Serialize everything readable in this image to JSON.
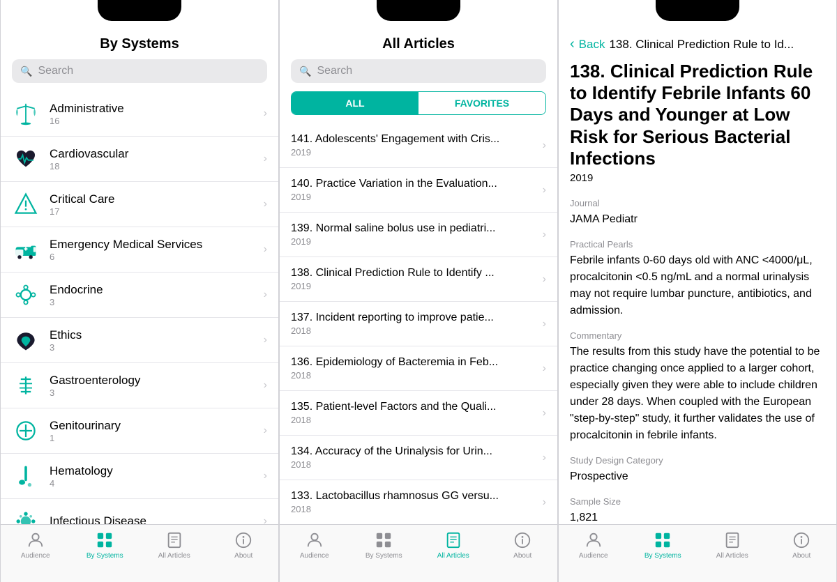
{
  "colors": {
    "accent": "#00b4a0",
    "text_primary": "#000000",
    "text_secondary": "#8e8e93",
    "border": "#e5e5ea",
    "search_bg": "#e9e9eb",
    "tab_bg": "#f9f9f9"
  },
  "phone1": {
    "title": "By Systems",
    "search_placeholder": "Search",
    "categories": [
      {
        "name": "Administrative",
        "count": "16",
        "icon": "scales"
      },
      {
        "name": "Cardiovascular",
        "count": "18",
        "icon": "heart"
      },
      {
        "name": "Critical Care",
        "count": "17",
        "icon": "warning"
      },
      {
        "name": "Emergency Medical Services",
        "count": "6",
        "icon": "ambulance"
      },
      {
        "name": "Endocrine",
        "count": "3",
        "icon": "gear-bio"
      },
      {
        "name": "Ethics",
        "count": "3",
        "icon": "cloud-heart"
      },
      {
        "name": "Gastroenterology",
        "count": "3",
        "icon": "fork-knife"
      },
      {
        "name": "Genitourinary",
        "count": "1",
        "icon": "cross-circle"
      },
      {
        "name": "Hematology",
        "count": "4",
        "icon": "syringe"
      },
      {
        "name": "Infectious Disease",
        "count": "",
        "icon": "virus"
      }
    ],
    "tabs": [
      {
        "label": "Audience",
        "icon": "person",
        "active": false
      },
      {
        "label": "By Systems",
        "icon": "grid",
        "active": true
      },
      {
        "label": "All Articles",
        "icon": "book",
        "active": false
      },
      {
        "label": "About",
        "icon": "info",
        "active": false
      }
    ]
  },
  "phone2": {
    "title": "All Articles",
    "search_placeholder": "Search",
    "segment": {
      "all": "ALL",
      "favorites": "FAVORITES"
    },
    "articles": [
      {
        "title": "141. Adolescents' Engagement with Cris...",
        "year": "2019"
      },
      {
        "title": "140. Practice Variation in the Evaluation...",
        "year": "2019"
      },
      {
        "title": "139. Normal saline bolus use in pediatri...",
        "year": "2019"
      },
      {
        "title": "138. Clinical Prediction Rule to Identify ...",
        "year": "2019"
      },
      {
        "title": "137. Incident reporting to improve patie...",
        "year": "2018"
      },
      {
        "title": "136. Epidemiology of Bacteremia in Feb...",
        "year": "2018"
      },
      {
        "title": "135. Patient-level Factors and the Quali...",
        "year": "2018"
      },
      {
        "title": "134. Accuracy of the Urinalysis for Urin...",
        "year": "2018"
      },
      {
        "title": "133. Lactobacillus rhamnosus GG versu...",
        "year": "2018"
      }
    ],
    "tabs": [
      {
        "label": "Audience",
        "icon": "person",
        "active": false
      },
      {
        "label": "By Systems",
        "icon": "grid",
        "active": false
      },
      {
        "label": "All Articles",
        "icon": "book",
        "active": true
      },
      {
        "label": "About",
        "icon": "info",
        "active": false
      }
    ]
  },
  "phone3": {
    "back_label": "Back",
    "back_title": "138. Clinical Prediction Rule to Id...",
    "article": {
      "title": "138. Clinical Prediction Rule to Identify Febrile Infants 60 Days and Younger at Low Risk for Serious Bacterial Infections",
      "year": "2019",
      "journal_label": "Journal",
      "journal_value": "JAMA Pediatr",
      "pearls_label": "Practical Pearls",
      "pearls_value": "Febrile infants 0-60 days old with ANC <4000/μL, procalcitonin <0.5 ng/mL and a normal urinalysis may not require lumbar puncture, antibiotics, and admission.",
      "commentary_label": "Commentary",
      "commentary_value": "The results from this study have the potential to be practice changing once applied to a larger cohort, especially given they were able to include children under 28 days. When coupled with the European \"step-by-step\" study, it further validates the use of procalcitonin in febrile infants.",
      "study_label": "Study Design Category",
      "study_value": "Prospective",
      "sample_label": "Sample Size",
      "sample_value": "1,821"
    },
    "tabs": [
      {
        "label": "Audience",
        "icon": "person",
        "active": false
      },
      {
        "label": "By Systems",
        "icon": "grid",
        "active": true
      },
      {
        "label": "All Articles",
        "icon": "book",
        "active": false
      },
      {
        "label": "About",
        "icon": "info",
        "active": false
      }
    ]
  }
}
